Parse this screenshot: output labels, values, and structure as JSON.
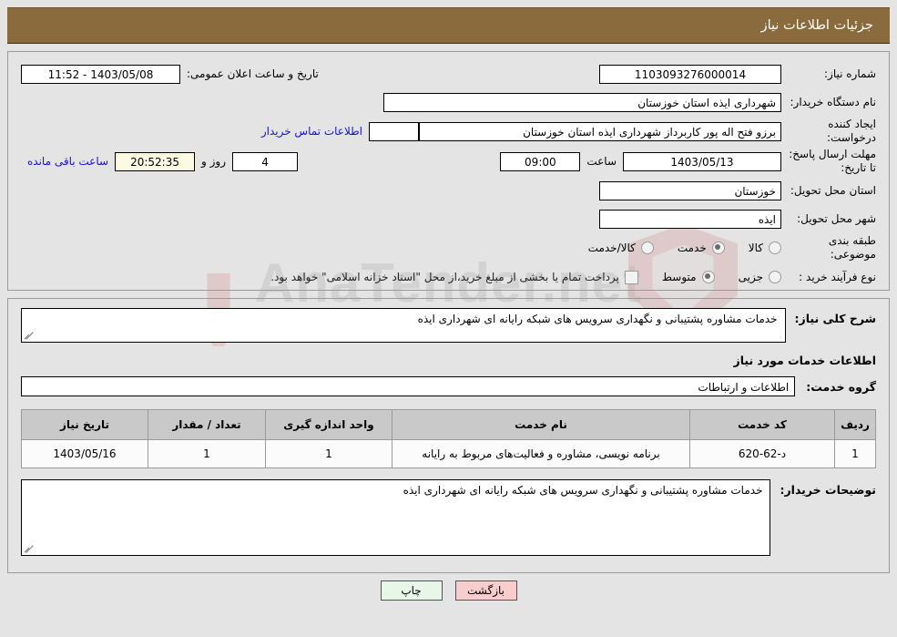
{
  "header": {
    "title": "جزئیات اطلاعات نیاز"
  },
  "watermark": {
    "text": "AnaTender.net"
  },
  "summary": {
    "need_number_label": "شماره نیاز:",
    "need_number_value": "1103093276000014",
    "announce_label": "تاریخ و ساعت اعلان عمومی:",
    "announce_value": "1403/05/08 - 11:52",
    "buyer_org_label": "نام دستگاه خریدار:",
    "buyer_org_value": "شهرداری ایذه استان خوزستان",
    "creator_label": "ایجاد کننده درخواست:",
    "creator_value": "برزو فتح اله پور کاربرداز شهرداری ایذه استان خوزستان",
    "contact_link": "اطلاعات تماس خریدار",
    "deadline_label": "مهلت ارسال پاسخ: تا تاریخ:",
    "deadline_date": "1403/05/13",
    "deadline_hour_label": "ساعت",
    "deadline_hour": "09:00",
    "remaining_days": "4",
    "remaining_days_label": "روز و",
    "remaining_time": "20:52:35",
    "remaining_time_label": "ساعت باقی مانده",
    "province_label": "استان محل تحویل:",
    "province_value": "خوزستان",
    "city_label": "شهر محل تحویل:",
    "city_value": "ایذه",
    "category_label": "طبقه بندی موضوعی:",
    "category_options": [
      {
        "label": "کالا",
        "checked": false
      },
      {
        "label": "خدمت",
        "checked": true
      },
      {
        "label": "کالا/خدمت",
        "checked": false
      }
    ],
    "process_label": "نوع فرآیند خرید :",
    "process_options": [
      {
        "label": "جزیی",
        "checked": false
      },
      {
        "label": "متوسط",
        "checked": true
      }
    ],
    "treasury_note": "پرداخت تمام یا بخشی از مبلغ خرید،از محل \"اسناد خزانه اسلامی\" خواهد بود."
  },
  "general": {
    "label": "شرح کلی نیاز:",
    "value": "خدمات مشاوره پشتیبانی و نگهداری سرویس های شبکه رایانه ای شهرداری ایذه"
  },
  "services": {
    "heading": "اطلاعات خدمات مورد نیاز",
    "group_label": "گروه خدمت:",
    "group_value": "اطلاعات و ارتباطات",
    "columns": [
      "ردیف",
      "کد خدمت",
      "نام خدمت",
      "واحد اندازه گیری",
      "تعداد / مقدار",
      "تاریخ نیاز"
    ],
    "rows": [
      {
        "index": "1",
        "code": "د-62-620",
        "name": "برنامه نویسی، مشاوره و فعالیت‌های مربوط به رایانه",
        "unit": "1",
        "quantity": "1",
        "need_date": "1403/05/16"
      }
    ]
  },
  "buyer_notes": {
    "label": "توضیحات خریدار:",
    "value": "خدمات مشاوره پشتیبانی و نگهداری سرویس های شبکه رایانه ای شهرداری ایذه"
  },
  "footer": {
    "print_label": "چاپ",
    "back_label": "بازگشت"
  }
}
